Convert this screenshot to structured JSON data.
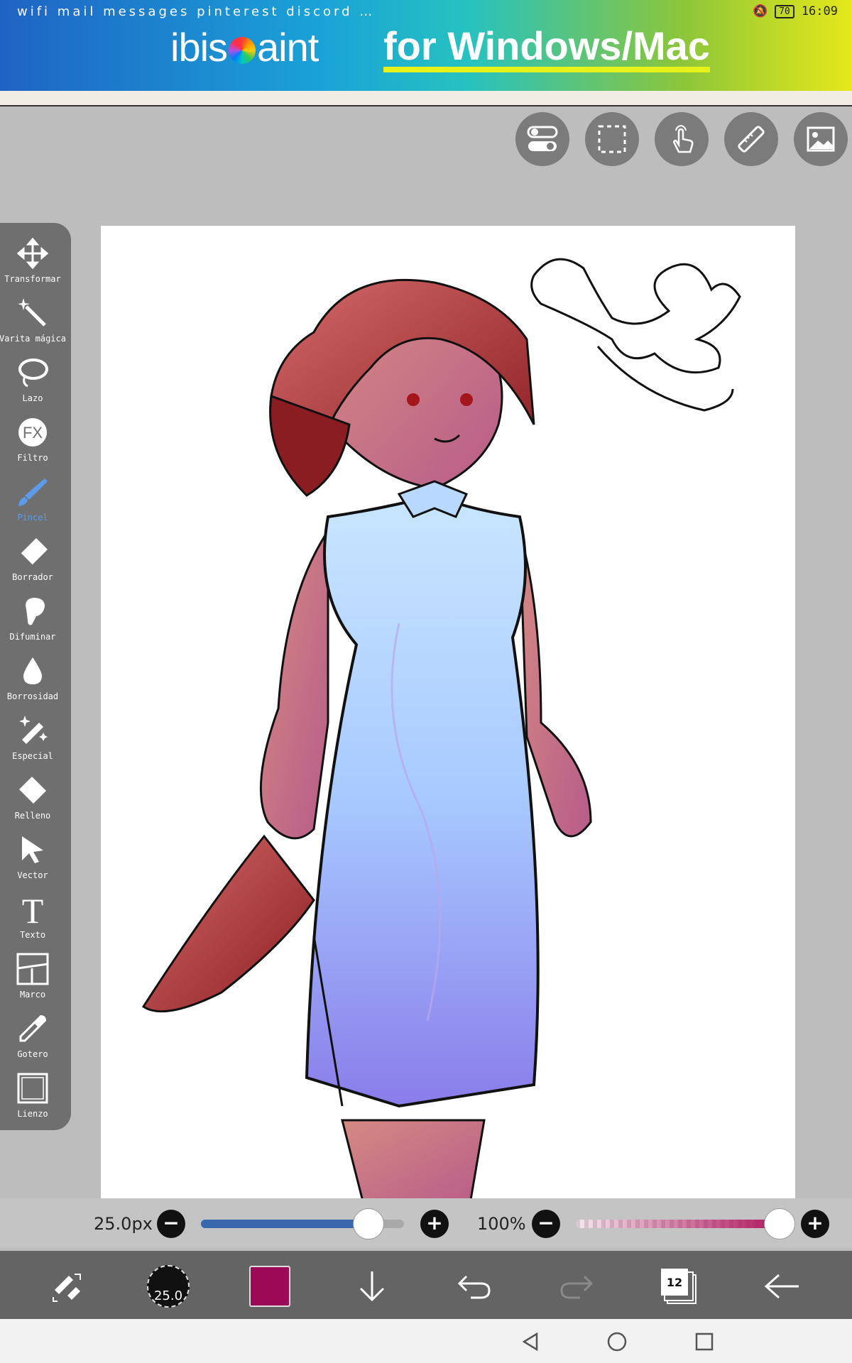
{
  "status": {
    "left_icons": "wifi mail messages pinterest discord …",
    "battery": "70",
    "time": "16:09"
  },
  "banner": {
    "brand_left": "ibis",
    "brand_right": "aint",
    "tagline": "for Windows/Mac"
  },
  "top_tools": [
    {
      "name": "toggle-icon"
    },
    {
      "name": "selection-icon"
    },
    {
      "name": "touch-icon"
    },
    {
      "name": "ruler-icon"
    },
    {
      "name": "image-icon"
    }
  ],
  "tools": [
    {
      "label": "Transformar",
      "icon": "move-icon"
    },
    {
      "label": "Varita mágica",
      "icon": "magic-wand-icon"
    },
    {
      "label": "Lazo",
      "icon": "lasso-icon"
    },
    {
      "label": "Filtro",
      "icon": "fx-icon",
      "text": "FX"
    },
    {
      "label": "Pincel",
      "icon": "brush-icon"
    },
    {
      "label": "Borrador",
      "icon": "eraser-icon"
    },
    {
      "label": "Difuminar",
      "icon": "smudge-icon"
    },
    {
      "label": "Borrosidad",
      "icon": "blur-icon"
    },
    {
      "label": "Especial",
      "icon": "special-icon"
    },
    {
      "label": "Relleno",
      "icon": "fill-icon"
    },
    {
      "label": "Vector",
      "icon": "vector-icon"
    },
    {
      "label": "Texto",
      "icon": "text-icon",
      "text": "T"
    },
    {
      "label": "Marco",
      "icon": "frame-icon"
    },
    {
      "label": "Gotero",
      "icon": "eyedropper-icon"
    },
    {
      "label": "Lienzo",
      "icon": "canvas-icon"
    }
  ],
  "active_tool": "Pincel",
  "brush": {
    "size_text": "25.0px",
    "size_fraction": 0.82,
    "opacity_text": "100%",
    "opacity_fraction": 1.0,
    "minus": "−",
    "plus": "+"
  },
  "bottom": {
    "brush_preview_value": "25.0",
    "current_color": "#9c0a57",
    "layers_count": "12"
  },
  "colors": {
    "accent_blue": "#5b9bea",
    "size_track": "#3a66ad",
    "opacity_track": "#b0195f"
  }
}
